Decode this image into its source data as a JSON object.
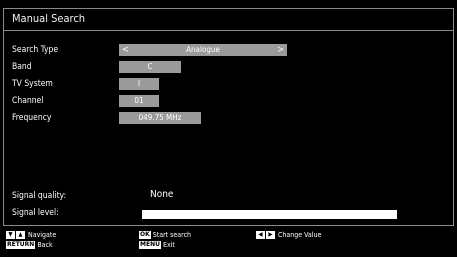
{
  "window": {
    "title": "Manual Search"
  },
  "fields": [
    {
      "label": "Search Type",
      "value": "Analogue",
      "left_arrow": "<",
      "right_arrow": ">"
    },
    {
      "label": "Band",
      "value": "C"
    },
    {
      "label": "TV System",
      "value": "I"
    },
    {
      "label": "Channel",
      "value": "01"
    },
    {
      "label": "Frequency",
      "value": "049.75 MHz"
    }
  ],
  "signal": {
    "quality_label": "Signal quality:",
    "quality_value": "None",
    "level_label": "Signal level:",
    "level_fraction": 1.0
  },
  "footer": {
    "navigate": {
      "keys": [
        "▼",
        "▲"
      ],
      "text": "Navigate"
    },
    "back": {
      "key": "RETURN",
      "text": "Back"
    },
    "start": {
      "key": "OK",
      "text": "Start search"
    },
    "exit": {
      "key": "MENU",
      "text": "Exit"
    },
    "change": {
      "keys": [
        "◀",
        "▶"
      ],
      "text": "Change Value"
    }
  },
  "colors": {
    "background": "#000000",
    "value_box": "#9a9a9a",
    "border": "#8a8a8a"
  }
}
